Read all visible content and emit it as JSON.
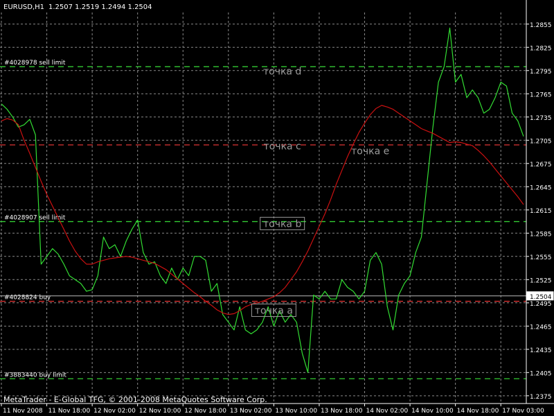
{
  "header": {
    "symbol": "EURUSD,H1",
    "ohlc": "1.2507 1.2519 1.2494 1.2504"
  },
  "footer": {
    "copyright": "MetaTrader - E-Global TFG, © 2001-2008 MetaQuotes Software Corp."
  },
  "colors": {
    "background": "#000000",
    "grid": "#8a8a8a",
    "axis": "#ffffff",
    "price_line": "#33dd33",
    "moving_average": "#cc1111",
    "limit_lines": "#33cc33",
    "buy_stop_lines": "#dd3333",
    "current_price_line": "#bbbbbb",
    "annotation_text": "#9a9a9a"
  },
  "chart_data": {
    "type": "line",
    "ylim": [
      1.2365,
      1.287
    ],
    "y_ticks": [
      "1.2855",
      "1.2825",
      "1.2795",
      "1.2765",
      "1.2735",
      "1.2705",
      "1.2675",
      "1.2645",
      "1.2615",
      "1.2585",
      "1.2555",
      "1.2525",
      "1.2495",
      "1.2465",
      "1.2435",
      "1.2405",
      "1.2375"
    ],
    "x_ticks": [
      "11 Nov 2008",
      "11 Nov 18:00",
      "12 Nov 02:00",
      "12 Nov 10:00",
      "12 Nov 18:00",
      "13 Nov 02:00",
      "13 Nov 10:00",
      "13 Nov 18:00",
      "14 Nov 02:00",
      "14 Nov 10:00",
      "14 Nov 18:00",
      "17 Nov 03:00"
    ],
    "x_tick_bars": [
      0,
      8,
      16,
      24,
      32,
      40,
      48,
      56,
      64,
      72,
      80,
      88
    ],
    "bar_count": 93,
    "series": [
      {
        "values": [
          1.2752,
          1.2745,
          1.2735,
          1.2722,
          1.2725,
          1.2732,
          1.2712,
          1.2545,
          1.2555,
          1.2565,
          1.2558,
          1.2545,
          1.253,
          1.2525,
          1.252,
          1.251,
          1.2512,
          1.253,
          1.258,
          1.2565,
          1.257,
          1.2555,
          1.2575,
          1.259,
          1.2602,
          1.256,
          1.2545,
          1.2548,
          1.253,
          1.252,
          1.254,
          1.2525,
          1.254,
          1.253,
          1.2555,
          1.2555,
          1.255,
          1.251,
          1.252,
          1.248,
          1.247,
          1.246,
          1.249,
          1.246,
          1.2455,
          1.246,
          1.247,
          1.249,
          1.2465,
          1.2485,
          1.247,
          1.248,
          1.247,
          1.243,
          1.2405,
          1.2505,
          1.25,
          1.251,
          1.25,
          1.25,
          1.2525,
          1.2515,
          1.251,
          1.25,
          1.251,
          1.255,
          1.256,
          1.2545,
          1.249,
          1.246,
          1.2505,
          1.252,
          1.253,
          1.256,
          1.258,
          1.265,
          1.272,
          1.278,
          1.28,
          1.285,
          1.278,
          1.279,
          1.276,
          1.277,
          1.276,
          1.274,
          1.2745,
          1.276,
          1.278,
          1.2775,
          1.274,
          1.273,
          1.271
        ]
      },
      {
        "values": [
          1.273,
          1.2733,
          1.2731,
          1.2725,
          1.2705,
          1.2688,
          1.267,
          1.2652,
          1.2635,
          1.262,
          1.2605,
          1.259,
          1.2575,
          1.2562,
          1.2552,
          1.2545,
          1.2545,
          1.2548,
          1.255,
          1.2552,
          1.2553,
          1.2554,
          1.2555,
          1.2554,
          1.2552,
          1.255,
          1.2548,
          1.2546,
          1.2542,
          1.2538,
          1.2532,
          1.2526,
          1.252,
          1.2514,
          1.2508,
          1.2503,
          1.2497,
          1.2492,
          1.2486,
          1.2482,
          1.248,
          1.2481,
          1.2485,
          1.249,
          1.2493,
          1.2495,
          1.2497,
          1.25,
          1.2503,
          1.2508,
          1.2515,
          1.2525,
          1.2535,
          1.2548,
          1.2562,
          1.2578,
          1.2594,
          1.261,
          1.2628,
          1.2648,
          1.2666,
          1.2684,
          1.27,
          1.2715,
          1.2727,
          1.2738,
          1.2746,
          1.275,
          1.2748,
          1.2745,
          1.274,
          1.2735,
          1.273,
          1.2725,
          1.272,
          1.2717,
          1.2714,
          1.271,
          1.2706,
          1.2702,
          1.2703,
          1.2702,
          1.27,
          1.2698,
          1.2692,
          1.2685,
          1.2677,
          1.2668,
          1.2659,
          1.265,
          1.2641,
          1.2632,
          1.2622
        ]
      }
    ],
    "price_overrides": {
      "note_free": true
    },
    "horizontal_lines": [
      {
        "label": "#4028978 sell limit",
        "value": 1.28,
        "kind": "limit"
      },
      {
        "label": "",
        "value": 1.2699,
        "kind": "stop"
      },
      {
        "label": "#4028907 sell limit",
        "value": 1.26,
        "kind": "limit"
      },
      {
        "label": "#4028824 buy",
        "value": 1.2497,
        "kind": "stop"
      },
      {
        "label": "#3883440 buy limit",
        "value": 1.2397,
        "kind": "limit"
      }
    ],
    "current_price": {
      "value": 1.2504,
      "label": "1.2504"
    },
    "annotations": [
      {
        "text": "точка d",
        "bar": 49.5,
        "value": 1.279,
        "boxed": false
      },
      {
        "text": "точка c",
        "bar": 49.5,
        "value": 1.2693,
        "boxed": false
      },
      {
        "text": "точка e",
        "bar": 65,
        "value": 1.2687,
        "boxed": false
      },
      {
        "text": "точка b",
        "bar": 49.5,
        "value": 1.2593,
        "boxed": true
      },
      {
        "text": "точка a",
        "bar": 48,
        "value": 1.2481,
        "boxed": true
      }
    ]
  }
}
